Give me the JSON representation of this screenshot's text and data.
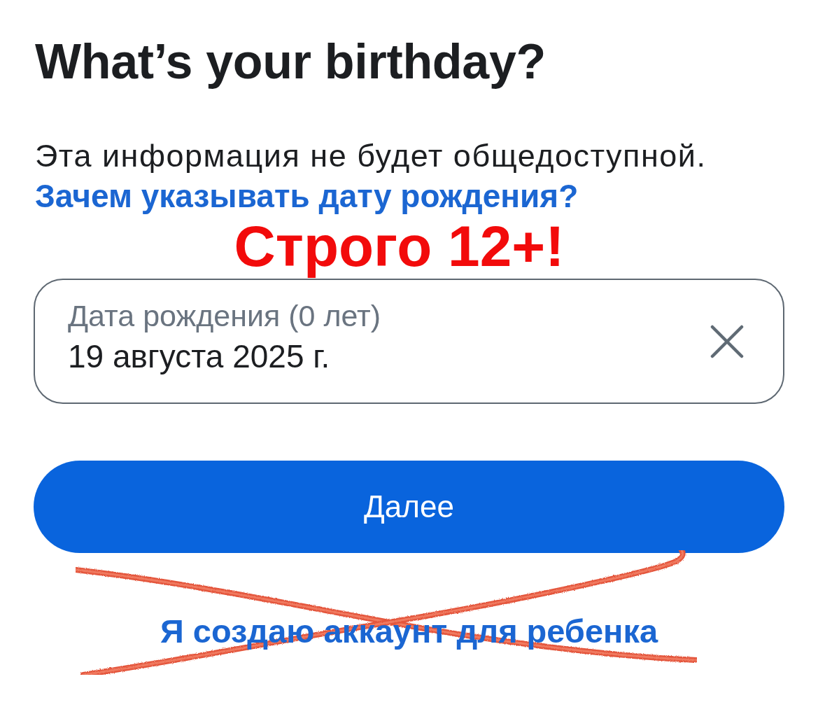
{
  "heading": {
    "title": "What’s your birthday?"
  },
  "info": {
    "text": "Эта информация не будет общедоступной.",
    "link": "Зачем указывать дату рождения?"
  },
  "annotation": {
    "text": "Строго 12+!"
  },
  "birthday_field": {
    "label": "Дата рождения (0 лет)",
    "value": "19 августа 2025 г."
  },
  "next_button": {
    "label": "Далее"
  },
  "child_account_link": {
    "label": "Я создаю аккаунт для ребенка",
    "crossed_out": true
  }
}
